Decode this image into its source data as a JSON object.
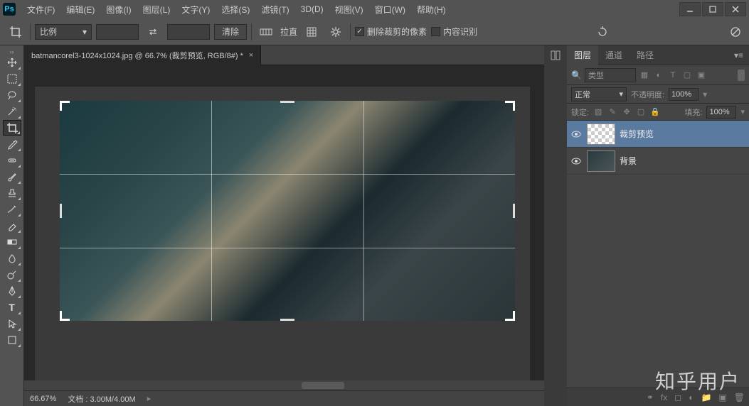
{
  "app": {
    "logo_text": "Ps"
  },
  "menu": {
    "file": "文件(F)",
    "edit": "编辑(E)",
    "image": "图像(I)",
    "layer": "图层(L)",
    "type": "文字(Y)",
    "select": "选择(S)",
    "filter": "滤镜(T)",
    "3d": "3D(D)",
    "view": "视图(V)",
    "window": "窗口(W)",
    "help": "帮助(H)"
  },
  "options": {
    "ratio_label": "比例",
    "clear": "清除",
    "straighten": "拉直",
    "delete_cropped": "删除裁剪的像素",
    "content_aware": "内容识别",
    "delete_checked": "✓"
  },
  "doc": {
    "title": "batmancorel3-1024x1024.jpg @ 66.7% (裁剪预览, RGB/8#) *"
  },
  "status": {
    "zoom": "66.67%",
    "doc_size": "文档 : 3.00M/4.00M"
  },
  "panels": {
    "layers": "图层",
    "channels": "通道",
    "paths": "路径",
    "filter_type": "类型",
    "blend_mode": "正常",
    "opacity_label": "不透明度:",
    "opacity_value": "100%",
    "lock_label": "锁定:",
    "fill_label": "填充:",
    "fill_value": "100%"
  },
  "layers": [
    {
      "name": "裁剪预览",
      "selected": true,
      "checker": true
    },
    {
      "name": "背景",
      "selected": false,
      "checker": false
    }
  ],
  "watermark": "知乎用户"
}
